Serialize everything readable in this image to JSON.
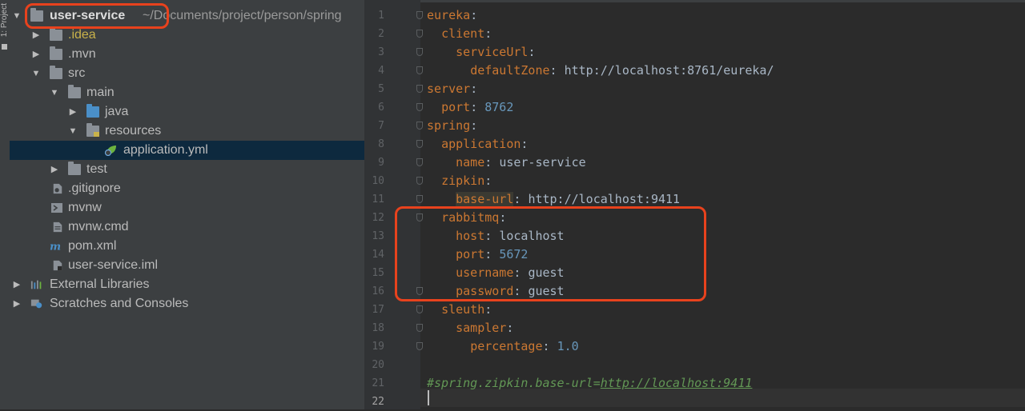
{
  "sidebar_tab": {
    "label": "1: Project"
  },
  "project_tree": {
    "root": {
      "name": "user-service",
      "path": "~/Documents/project/person/spring"
    },
    "items": [
      {
        "label": ".idea"
      },
      {
        "label": ".mvn"
      },
      {
        "label": "src"
      },
      {
        "label": "main"
      },
      {
        "label": "java"
      },
      {
        "label": "resources"
      },
      {
        "label": "application.yml"
      },
      {
        "label": "test"
      },
      {
        "label": ".gitignore"
      },
      {
        "label": "mvnw"
      },
      {
        "label": "mvnw.cmd"
      },
      {
        "label": "pom.xml"
      },
      {
        "label": "user-service.iml"
      },
      {
        "label": "External Libraries"
      },
      {
        "label": "Scratches and Consoles"
      }
    ]
  },
  "editor": {
    "line_numbers": [
      "1",
      "2",
      "3",
      "4",
      "5",
      "6",
      "7",
      "8",
      "9",
      "10",
      "11",
      "12",
      "13",
      "14",
      "15",
      "16",
      "17",
      "18",
      "19",
      "20",
      "21",
      "22"
    ],
    "tokens": {
      "eureka": "eureka",
      "client": "client",
      "serviceUrl": "serviceUrl",
      "defaultZone": "defaultZone",
      "defaultZone_value": "http://localhost:8761/eureka/",
      "server": "server",
      "port": "port",
      "server_port_value": "8762",
      "spring": "spring",
      "application": "application",
      "name": "name",
      "name_value": "user-service",
      "zipkin": "zipkin",
      "base_url": "base-url",
      "base_url_value": "http://localhost:9411",
      "rabbitmq": "rabbitmq",
      "host": "host",
      "host_value": "localhost",
      "rabbit_port_value": "5672",
      "username": "username",
      "username_value": "guest",
      "password": "password",
      "password_value": "guest",
      "sleuth": "sleuth",
      "sampler": "sampler",
      "percentage": "percentage",
      "percentage_value": "1.0",
      "comment_prefix": "#spring.zipkin.base-url=",
      "comment_url": "http://localhost:9411"
    }
  },
  "colors": {
    "callout": "#e8421d",
    "key": "#cc7832",
    "number": "#6897bb",
    "comment": "#629755"
  }
}
